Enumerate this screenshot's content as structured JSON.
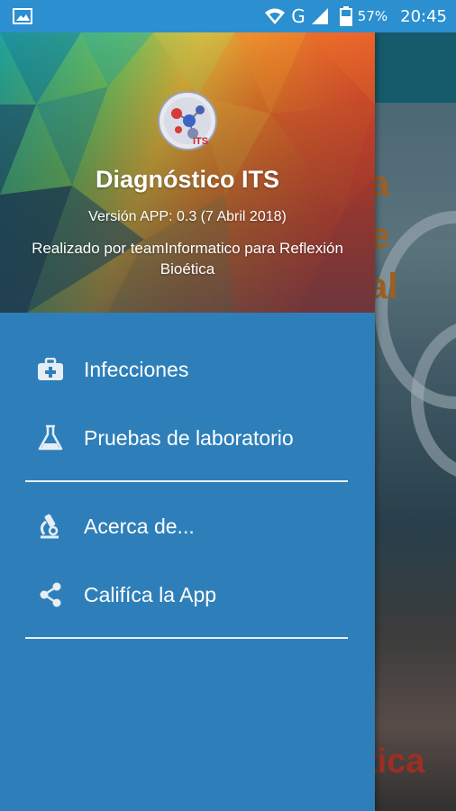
{
  "status_bar": {
    "icons": [
      "image-icon",
      "wifi-icon",
      "signal-icon",
      "battery-icon"
    ],
    "network_type": "G",
    "battery": "57%",
    "time": "20:45"
  },
  "header": {
    "app_name": "Diagnóstico ITS",
    "version": "Versión APP: 0.3 (7 Abril 2018)",
    "credit": "Realizado por teamInformatico para Reflexión Bioética"
  },
  "menu": {
    "items": [
      {
        "label": "Infecciones",
        "icon": "medkit-icon"
      },
      {
        "label": "Pruebas de laboratorio",
        "icon": "flask-icon"
      },
      {
        "label": "Acerca de...",
        "icon": "microscope-icon"
      },
      {
        "label": "Califíca la App",
        "icon": "share-icon"
      }
    ]
  },
  "colors": {
    "status_bar": "#2b8fd0",
    "drawer": "#2e7fb9",
    "divider": "#e6f0f7",
    "text": "#ffffff"
  }
}
